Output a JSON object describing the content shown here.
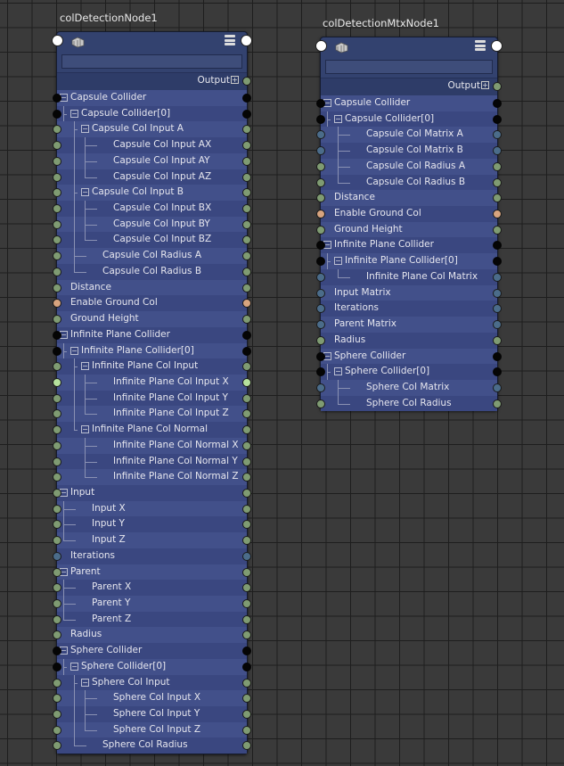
{
  "nodes": [
    {
      "title": "colDetectionNode1",
      "output_label": "Output",
      "name_value": "",
      "rows": [
        {
          "label": "Capsule Collider",
          "depth": 0,
          "exp": true,
          "lines": [],
          "l": "black",
          "r": "black"
        },
        {
          "label": "Capsule Collider[0]",
          "depth": 1,
          "exp": true,
          "lines": [
            [
              "elbow",
              0
            ]
          ],
          "l": "black",
          "r": "black"
        },
        {
          "label": "Capsule Col Input A",
          "depth": 2,
          "exp": true,
          "lines": [
            [
              "elbow",
              1
            ]
          ],
          "l": "green",
          "r": "green"
        },
        {
          "label": "Capsule Col Input AX",
          "depth": 3,
          "exp": false,
          "lines": [
            [
              "pass",
              1
            ],
            [
              "elbow",
              2
            ]
          ],
          "l": "green",
          "r": "green"
        },
        {
          "label": "Capsule Col Input AY",
          "depth": 3,
          "exp": false,
          "lines": [
            [
              "pass",
              1
            ],
            [
              "elbow",
              2
            ]
          ],
          "l": "green",
          "r": "green"
        },
        {
          "label": "Capsule Col Input AZ",
          "depth": 3,
          "exp": false,
          "lines": [
            [
              "pass",
              1
            ],
            [
              "elbowend",
              2
            ]
          ],
          "l": "green",
          "r": "green"
        },
        {
          "label": "Capsule Col Input B",
          "depth": 2,
          "exp": true,
          "lines": [
            [
              "elbow",
              1
            ]
          ],
          "l": "green",
          "r": "green"
        },
        {
          "label": "Capsule Col Input BX",
          "depth": 3,
          "exp": false,
          "lines": [
            [
              "pass",
              1
            ],
            [
              "elbow",
              2
            ]
          ],
          "l": "green",
          "r": "green"
        },
        {
          "label": "Capsule Col Input BY",
          "depth": 3,
          "exp": false,
          "lines": [
            [
              "pass",
              1
            ],
            [
              "elbow",
              2
            ]
          ],
          "l": "green",
          "r": "green"
        },
        {
          "label": "Capsule Col Input BZ",
          "depth": 3,
          "exp": false,
          "lines": [
            [
              "pass",
              1
            ],
            [
              "elbowend",
              2
            ]
          ],
          "l": "green",
          "r": "green"
        },
        {
          "label": "Capsule Col Radius A",
          "depth": 2,
          "exp": false,
          "lines": [
            [
              "elbow",
              1
            ]
          ],
          "l": "green",
          "r": "green"
        },
        {
          "label": "Capsule Col Radius B",
          "depth": 2,
          "exp": false,
          "lines": [
            [
              "elbowend",
              1
            ]
          ],
          "l": "green",
          "r": "green"
        },
        {
          "label": "Distance",
          "depth": 0,
          "exp": false,
          "lines": [],
          "l": "green",
          "r": "green"
        },
        {
          "label": "Enable Ground Col",
          "depth": 0,
          "exp": false,
          "lines": [],
          "l": "orange",
          "r": "orange"
        },
        {
          "label": "Ground Height",
          "depth": 0,
          "exp": false,
          "lines": [],
          "l": "green",
          "r": "green"
        },
        {
          "label": "Infinite Plane Collider",
          "depth": 0,
          "exp": true,
          "lines": [],
          "l": "black",
          "r": "black"
        },
        {
          "label": "Infinite Plane Collider[0]",
          "depth": 1,
          "exp": true,
          "lines": [
            [
              "elbow",
              0
            ]
          ],
          "l": "black",
          "r": "black"
        },
        {
          "label": "Infinite Plane Col Input",
          "depth": 2,
          "exp": true,
          "lines": [
            [
              "elbow",
              1
            ]
          ],
          "l": "green",
          "r": "green"
        },
        {
          "label": "Infinite Plane Col Input X",
          "depth": 3,
          "exp": false,
          "lines": [
            [
              "pass",
              1
            ],
            [
              "elbow",
              2
            ]
          ],
          "l": "bright",
          "r": "bright"
        },
        {
          "label": "Infinite Plane Col Input Y",
          "depth": 3,
          "exp": false,
          "lines": [
            [
              "pass",
              1
            ],
            [
              "elbow",
              2
            ]
          ],
          "l": "green",
          "r": "green"
        },
        {
          "label": "Infinite Plane Col Input Z",
          "depth": 3,
          "exp": false,
          "lines": [
            [
              "pass",
              1
            ],
            [
              "elbowend",
              2
            ]
          ],
          "l": "green",
          "r": "green"
        },
        {
          "label": "Infinite Plane Col Normal",
          "depth": 2,
          "exp": true,
          "lines": [
            [
              "elbowend",
              1
            ]
          ],
          "l": "green",
          "r": "green"
        },
        {
          "label": "Infinite Plane Col Normal X",
          "depth": 3,
          "exp": false,
          "lines": [
            [
              "elbow",
              2
            ]
          ],
          "l": "green",
          "r": "green"
        },
        {
          "label": "Infinite Plane Col Normal Y",
          "depth": 3,
          "exp": false,
          "lines": [
            [
              "elbow",
              2
            ]
          ],
          "l": "green",
          "r": "green"
        },
        {
          "label": "Infinite Plane Col Normal Z",
          "depth": 3,
          "exp": false,
          "lines": [
            [
              "elbowend",
              2
            ]
          ],
          "l": "green",
          "r": "green"
        },
        {
          "label": "Input",
          "depth": 0,
          "exp": true,
          "lines": [],
          "l": "green",
          "r": "green"
        },
        {
          "label": "Input X",
          "depth": 1,
          "exp": false,
          "lines": [
            [
              "elbow",
              0
            ]
          ],
          "l": "green",
          "r": "green"
        },
        {
          "label": "Input Y",
          "depth": 1,
          "exp": false,
          "lines": [
            [
              "elbow",
              0
            ]
          ],
          "l": "green",
          "r": "green"
        },
        {
          "label": "Input Z",
          "depth": 1,
          "exp": false,
          "lines": [
            [
              "elbowend",
              0
            ]
          ],
          "l": "green",
          "r": "green"
        },
        {
          "label": "Iterations",
          "depth": 0,
          "exp": false,
          "lines": [],
          "l": "blue",
          "r": "blue"
        },
        {
          "label": "Parent",
          "depth": 0,
          "exp": true,
          "lines": [],
          "l": "green",
          "r": "green"
        },
        {
          "label": "Parent X",
          "depth": 1,
          "exp": false,
          "lines": [
            [
              "elbow",
              0
            ]
          ],
          "l": "green",
          "r": "green"
        },
        {
          "label": "Parent Y",
          "depth": 1,
          "exp": false,
          "lines": [
            [
              "elbow",
              0
            ]
          ],
          "l": "green",
          "r": "green"
        },
        {
          "label": "Parent Z",
          "depth": 1,
          "exp": false,
          "lines": [
            [
              "elbowend",
              0
            ]
          ],
          "l": "green",
          "r": "green"
        },
        {
          "label": "Radius",
          "depth": 0,
          "exp": false,
          "lines": [],
          "l": "green",
          "r": "green"
        },
        {
          "label": "Sphere Collider",
          "depth": 0,
          "exp": true,
          "lines": [],
          "l": "black",
          "r": "black"
        },
        {
          "label": "Sphere Collider[0]",
          "depth": 1,
          "exp": true,
          "lines": [
            [
              "elbow",
              0
            ]
          ],
          "l": "black",
          "r": "black"
        },
        {
          "label": "Sphere Col Input",
          "depth": 2,
          "exp": true,
          "lines": [
            [
              "elbow",
              1
            ]
          ],
          "l": "green",
          "r": "green"
        },
        {
          "label": "Sphere Col Input X",
          "depth": 3,
          "exp": false,
          "lines": [
            [
              "pass",
              1
            ],
            [
              "elbow",
              2
            ]
          ],
          "l": "green",
          "r": "green"
        },
        {
          "label": "Sphere Col Input Y",
          "depth": 3,
          "exp": false,
          "lines": [
            [
              "pass",
              1
            ],
            [
              "elbow",
              2
            ]
          ],
          "l": "green",
          "r": "green"
        },
        {
          "label": "Sphere Col Input Z",
          "depth": 3,
          "exp": false,
          "lines": [
            [
              "pass",
              1
            ],
            [
              "elbowend",
              2
            ]
          ],
          "l": "green",
          "r": "green"
        },
        {
          "label": "Sphere Col Radius",
          "depth": 2,
          "exp": false,
          "lines": [
            [
              "elbowend",
              1
            ]
          ],
          "l": "green",
          "r": "green"
        }
      ]
    },
    {
      "title": "colDetectionMtxNode1",
      "output_label": "Output",
      "name_value": "",
      "rows": [
        {
          "label": "Capsule Collider",
          "depth": 0,
          "exp": true,
          "lines": [],
          "l": "black",
          "r": "black"
        },
        {
          "label": "Capsule Collider[0]",
          "depth": 1,
          "exp": true,
          "lines": [
            [
              "elbow",
              0
            ]
          ],
          "l": "black",
          "r": "black"
        },
        {
          "label": "Capsule Col Matrix A",
          "depth": 2,
          "exp": false,
          "lines": [
            [
              "elbow",
              1
            ]
          ],
          "l": "blue",
          "r": "blue"
        },
        {
          "label": "Capsule Col Matrix B",
          "depth": 2,
          "exp": false,
          "lines": [
            [
              "elbow",
              1
            ]
          ],
          "l": "blue",
          "r": "blue"
        },
        {
          "label": "Capsule Col Radius A",
          "depth": 2,
          "exp": false,
          "lines": [
            [
              "elbow",
              1
            ]
          ],
          "l": "green",
          "r": "green"
        },
        {
          "label": "Capsule Col Radius B",
          "depth": 2,
          "exp": false,
          "lines": [
            [
              "elbowend",
              1
            ]
          ],
          "l": "green",
          "r": "green"
        },
        {
          "label": "Distance",
          "depth": 0,
          "exp": false,
          "lines": [],
          "l": "green",
          "r": "green"
        },
        {
          "label": "Enable Ground Col",
          "depth": 0,
          "exp": false,
          "lines": [],
          "l": "orange",
          "r": "orange"
        },
        {
          "label": "Ground Height",
          "depth": 0,
          "exp": false,
          "lines": [],
          "l": "green",
          "r": "green"
        },
        {
          "label": "Infinite Plane Collider",
          "depth": 0,
          "exp": true,
          "lines": [],
          "l": "black",
          "r": "black"
        },
        {
          "label": "Infinite Plane Collider[0]",
          "depth": 1,
          "exp": true,
          "lines": [
            [
              "elbow",
              0
            ]
          ],
          "l": "black",
          "r": "black"
        },
        {
          "label": "Infinite Plane Col Matrix",
          "depth": 2,
          "exp": false,
          "lines": [
            [
              "elbowend",
              1
            ]
          ],
          "l": "blue",
          "r": "blue"
        },
        {
          "label": "Input Matrix",
          "depth": 0,
          "exp": false,
          "lines": [],
          "l": "blue",
          "r": "blue"
        },
        {
          "label": "Iterations",
          "depth": 0,
          "exp": false,
          "lines": [],
          "l": "blue",
          "r": "blue"
        },
        {
          "label": "Parent Matrix",
          "depth": 0,
          "exp": false,
          "lines": [],
          "l": "blue",
          "r": "blue"
        },
        {
          "label": "Radius",
          "depth": 0,
          "exp": false,
          "lines": [],
          "l": "green",
          "r": "green"
        },
        {
          "label": "Sphere Collider",
          "depth": 0,
          "exp": true,
          "lines": [],
          "l": "black",
          "r": "black"
        },
        {
          "label": "Sphere Collider[0]",
          "depth": 1,
          "exp": true,
          "lines": [
            [
              "elbow",
              0
            ]
          ],
          "l": "black",
          "r": "black"
        },
        {
          "label": "Sphere Col Matrix",
          "depth": 2,
          "exp": false,
          "lines": [
            [
              "elbow",
              1
            ]
          ],
          "l": "blue",
          "r": "blue"
        },
        {
          "label": "Sphere Col Radius",
          "depth": 2,
          "exp": false,
          "lines": [
            [
              "elbowend",
              1
            ]
          ],
          "l": "green",
          "r": "green"
        }
      ]
    }
  ]
}
